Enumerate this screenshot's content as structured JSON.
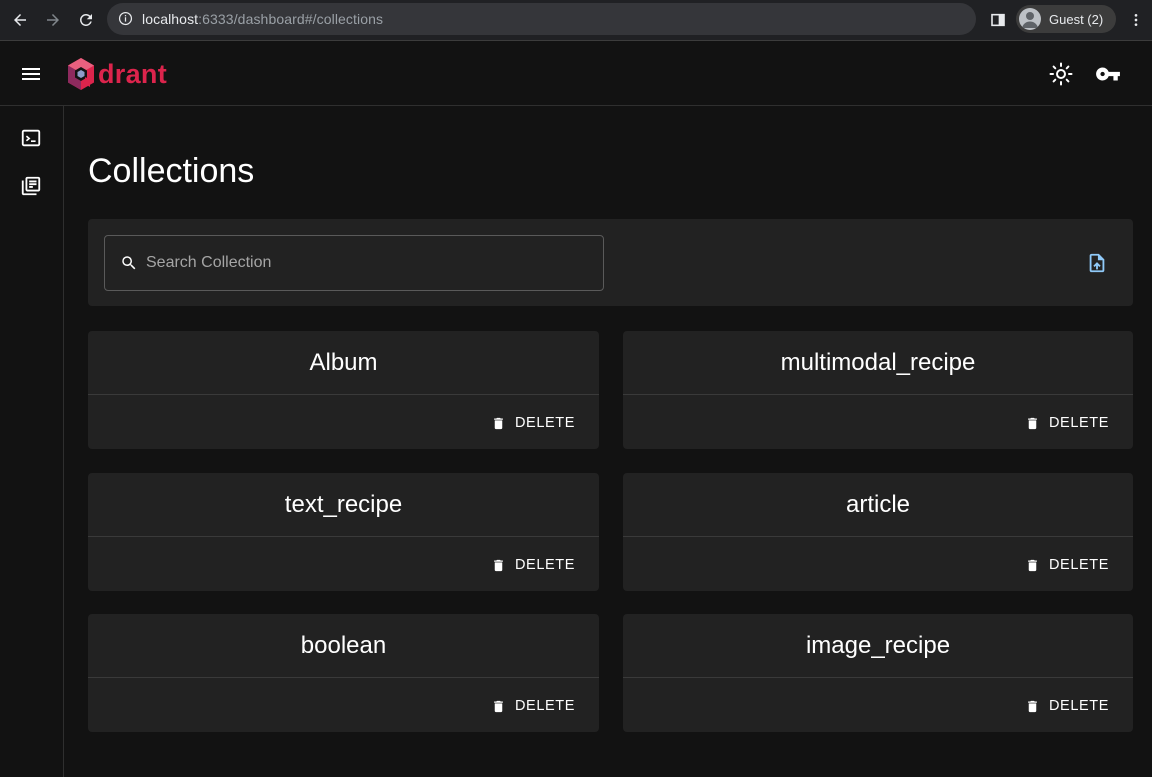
{
  "browser": {
    "url_host": "localhost",
    "url_path": ":6333/dashboard#/collections",
    "profile_label": "Guest (2)"
  },
  "app": {
    "logo_text": "drant",
    "brand_color": "#dc244c"
  },
  "main": {
    "title": "Collections",
    "search_placeholder": "Search Collection",
    "delete_label": "DELETE",
    "collections": [
      {
        "name": "Album"
      },
      {
        "name": "multimodal_recipe"
      },
      {
        "name": "text_recipe"
      },
      {
        "name": "article"
      },
      {
        "name": "boolean"
      },
      {
        "name": "image_recipe"
      }
    ]
  },
  "icons": {
    "sidebar": [
      "console-icon",
      "collections-icon"
    ],
    "appbar": [
      "menu-icon",
      "theme-toggle-icon",
      "api-key-icon"
    ],
    "toolbar": [
      "search-icon",
      "upload-snapshot-icon"
    ],
    "card": "trash-icon"
  }
}
